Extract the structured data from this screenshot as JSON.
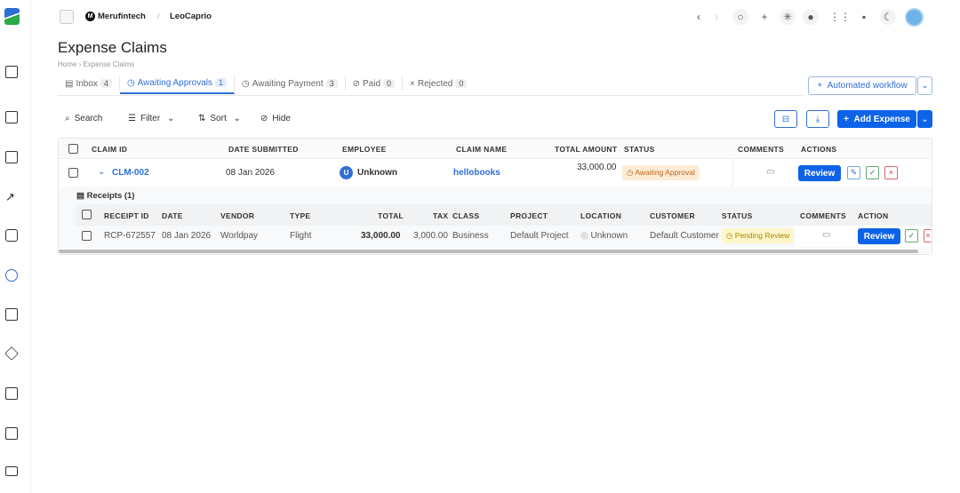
{
  "topbar": {
    "org": "Merufintech",
    "org_initial": "M",
    "user": "LeoCaprio",
    "separator": "/"
  },
  "page": {
    "title": "Expense Claims",
    "breadcrumb": [
      "Home",
      "Expense Claims"
    ]
  },
  "tabs": [
    {
      "label": "Inbox",
      "count": "4",
      "icon": "inbox-icon"
    },
    {
      "label": "Awaiting Approvals",
      "count": "1",
      "icon": "clock-icon",
      "active": true
    },
    {
      "label": "Awaiting Payment",
      "count": "3",
      "icon": "clock-icon"
    },
    {
      "label": "Paid",
      "count": "0",
      "icon": "check-circle-icon"
    },
    {
      "label": "Rejected",
      "count": "0",
      "icon": "x-icon"
    }
  ],
  "toolbar": {
    "search": "Search",
    "filter": "Filter",
    "sort": "Sort",
    "hide": "Hide",
    "automated_workflow": "Automated workflow",
    "add_expense": "Add Expense"
  },
  "claims_table": {
    "headers": [
      "CLAIM ID",
      "DATE SUBMITTED",
      "EMPLOYEE",
      "CLAIM NAME",
      "TOTAL AMOUNT",
      "STATUS",
      "COMMENTS",
      "ACTIONS"
    ],
    "rows": [
      {
        "claim_id": "CLM-002",
        "date": "08 Jan 2026",
        "employee": "Unknown",
        "employee_initial": "U",
        "claim_name": "hellobooks",
        "total": "33,000.00",
        "status": "Awaiting Approval",
        "review": "Review"
      }
    ]
  },
  "receipts": {
    "label": "Receipts (1)",
    "headers": [
      "RECEIPT ID",
      "DATE",
      "VENDOR",
      "TYPE",
      "TOTAL",
      "TAX",
      "CLASS",
      "PROJECT",
      "LOCATION",
      "CUSTOMER",
      "STATUS",
      "COMMENTS",
      "ACTION"
    ],
    "rows": [
      {
        "receipt_id": "RCP-672557",
        "date": "08 Jan 2026",
        "vendor": "Worldpay",
        "type": "Flight",
        "total": "33,000.00",
        "tax": "3,000.00",
        "class": "Business",
        "project": "Default Project",
        "location": "Unknown",
        "customer": "Default Customer",
        "status": "Pending Review",
        "review": "Review"
      }
    ]
  },
  "colors": {
    "primary": "#0d63e8",
    "awaiting_bg": "#fdebd6",
    "awaiting_fg": "#c0651a",
    "pending_bg": "#fdf6c8",
    "pending_fg": "#a8870c"
  }
}
